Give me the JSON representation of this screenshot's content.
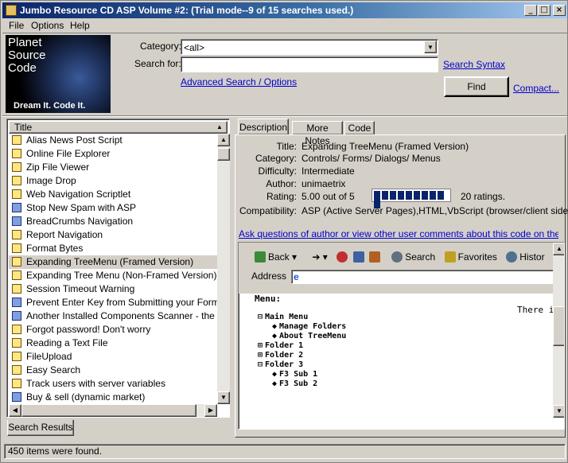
{
  "window": {
    "title": "Jumbo Resource CD ASP Volume #2: (Trial mode--9 of 15 searches used.)",
    "controls": {
      "minimize": "_",
      "maximize": "□",
      "close": "×"
    }
  },
  "menu": [
    "File",
    "Options",
    "Help"
  ],
  "logo": {
    "line1": "Planet",
    "line2": "Source",
    "line3": "Code",
    "tagline": "Dream It.  Code It."
  },
  "search": {
    "category_label": "Category:",
    "category_value": "<all>",
    "search_for_label": "Search for:",
    "search_for_value": "",
    "search_syntax_link": "Search Syntax",
    "advanced_link": "Advanced Search / Options",
    "find_button": "Find",
    "compact_link": "Compact..."
  },
  "results": {
    "header": "Title",
    "selected_index": 9,
    "items": [
      {
        "title": "Alias News Post Script",
        "icon": "code-file-icon"
      },
      {
        "title": "Online File Explorer",
        "icon": "code-file-icon"
      },
      {
        "title": "Zip File Viewer",
        "icon": "code-file-icon"
      },
      {
        "title": "Image Drop",
        "icon": "code-file-icon"
      },
      {
        "title": "Web Navigation Scriptlet",
        "icon": "code-file-icon"
      },
      {
        "title": "Stop New Spam with ASP",
        "icon": "code-file-icon"
      },
      {
        "title": "BreadCrumbs Navigation",
        "icon": "code-file-icon"
      },
      {
        "title": "Report Navigation",
        "icon": "code-file-icon"
      },
      {
        "title": "Format Bytes",
        "icon": "code-file-icon"
      },
      {
        "title": "Expanding TreeMenu (Framed Version)",
        "icon": "code-file-icon"
      },
      {
        "title": "Expanding Tree Menu (Non-Framed Version)",
        "icon": "code-file-icon"
      },
      {
        "title": "Session Timeout Warning",
        "icon": "code-file-icon"
      },
      {
        "title": "Prevent Enter Key from Submitting your Forms",
        "icon": "code-file-icon"
      },
      {
        "title": "Another Installed Components Scanner - the most ·",
        "icon": "code-file-icon"
      },
      {
        "title": "Forgot password! Don't worry",
        "icon": "code-file-icon"
      },
      {
        "title": "Reading a Text File",
        "icon": "code-file-icon"
      },
      {
        "title": "FileUpload",
        "icon": "code-file-icon"
      },
      {
        "title": "Easy Search",
        "icon": "code-file-icon"
      },
      {
        "title": "Track users with server variables",
        "icon": "code-file-icon"
      },
      {
        "title": "Buy & sell (dynamic market)",
        "icon": "code-file-icon"
      }
    ],
    "bottom_tab": "Search Results"
  },
  "detail": {
    "tabs": [
      "Description",
      "More Notes",
      "Code"
    ],
    "fields": {
      "title_label": "Title:",
      "title": "Expanding TreeMenu (Framed Version)",
      "category_label": "Category:",
      "category": "Controls/ Forms/ Dialogs/ Menus",
      "difficulty_label": "Difficulty:",
      "difficulty": "Intermediate",
      "author_label": "Author:",
      "author": "unimaetrix",
      "rating_label": "Rating:",
      "rating": "5.00 out of 5",
      "rating_fraction": 1.0,
      "ratings_count": "20 ratings.",
      "compat_label": "Compatibility:",
      "compat": "ASP (Active Server Pages),HTML,VbScript (browser/client side)"
    },
    "ask_link": "Ask questions of author or view other user comments about this code on the web...."
  },
  "browser": {
    "back": "Back",
    "search": "Search",
    "favorites": "Favorites",
    "history": "Histor",
    "address_label": "Address",
    "menu_label": "Menu:",
    "right_text": "There is",
    "tree": [
      {
        "sym": "⊟",
        "text": "Main Menu"
      },
      {
        "sym": "◆",
        "text": "Manage Folders"
      },
      {
        "sym": "◆",
        "text": "About TreeMenu"
      },
      {
        "sym": "⊞",
        "text": "Folder 1"
      },
      {
        "sym": "⊞",
        "text": "Folder 2"
      },
      {
        "sym": "⊟",
        "text": "Folder 3"
      },
      {
        "sym": "◆",
        "text": "F3 Sub 1"
      },
      {
        "sym": "◆",
        "text": "F3 Sub 2"
      }
    ]
  },
  "status": {
    "text": "450 items were found."
  }
}
